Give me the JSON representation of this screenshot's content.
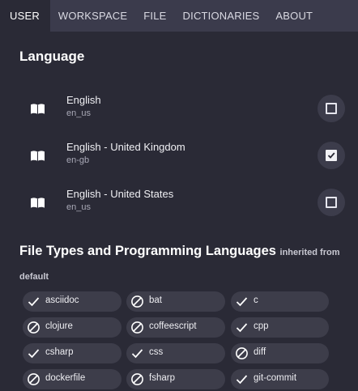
{
  "tabs": [
    {
      "label": "USER",
      "active": true
    },
    {
      "label": "WORKSPACE",
      "active": false
    },
    {
      "label": "FILE",
      "active": false
    },
    {
      "label": "DICTIONARIES",
      "active": false
    },
    {
      "label": "ABOUT",
      "active": false
    }
  ],
  "language_section": {
    "title": "Language",
    "items": [
      {
        "name": "English",
        "code": "en_us",
        "checked": false,
        "icon": "book-icon"
      },
      {
        "name": "English - United Kingdom",
        "code": "en-gb",
        "checked": true,
        "icon": "book-icon"
      },
      {
        "name": "English - United States",
        "code": "en_us",
        "checked": false,
        "icon": "book-icon"
      }
    ]
  },
  "filetypes_section": {
    "title": "File Types and Programming Languages",
    "inherited_label": "inherited from default",
    "chips": [
      {
        "label": "asciidoc",
        "state": "enabled"
      },
      {
        "label": "bat",
        "state": "disabled"
      },
      {
        "label": "c",
        "state": "enabled"
      },
      {
        "label": "clojure",
        "state": "disabled"
      },
      {
        "label": "coffeescript",
        "state": "disabled"
      },
      {
        "label": "cpp",
        "state": "enabled"
      },
      {
        "label": "csharp",
        "state": "enabled"
      },
      {
        "label": "css",
        "state": "enabled"
      },
      {
        "label": "diff",
        "state": "disabled"
      },
      {
        "label": "dockerfile",
        "state": "disabled"
      },
      {
        "label": "fsharp",
        "state": "disabled"
      },
      {
        "label": "git-commit",
        "state": "enabled"
      }
    ]
  },
  "colors": {
    "background": "#2a2a36",
    "tabbar": "#3b3b4c",
    "chip": "#3d3d4a"
  }
}
